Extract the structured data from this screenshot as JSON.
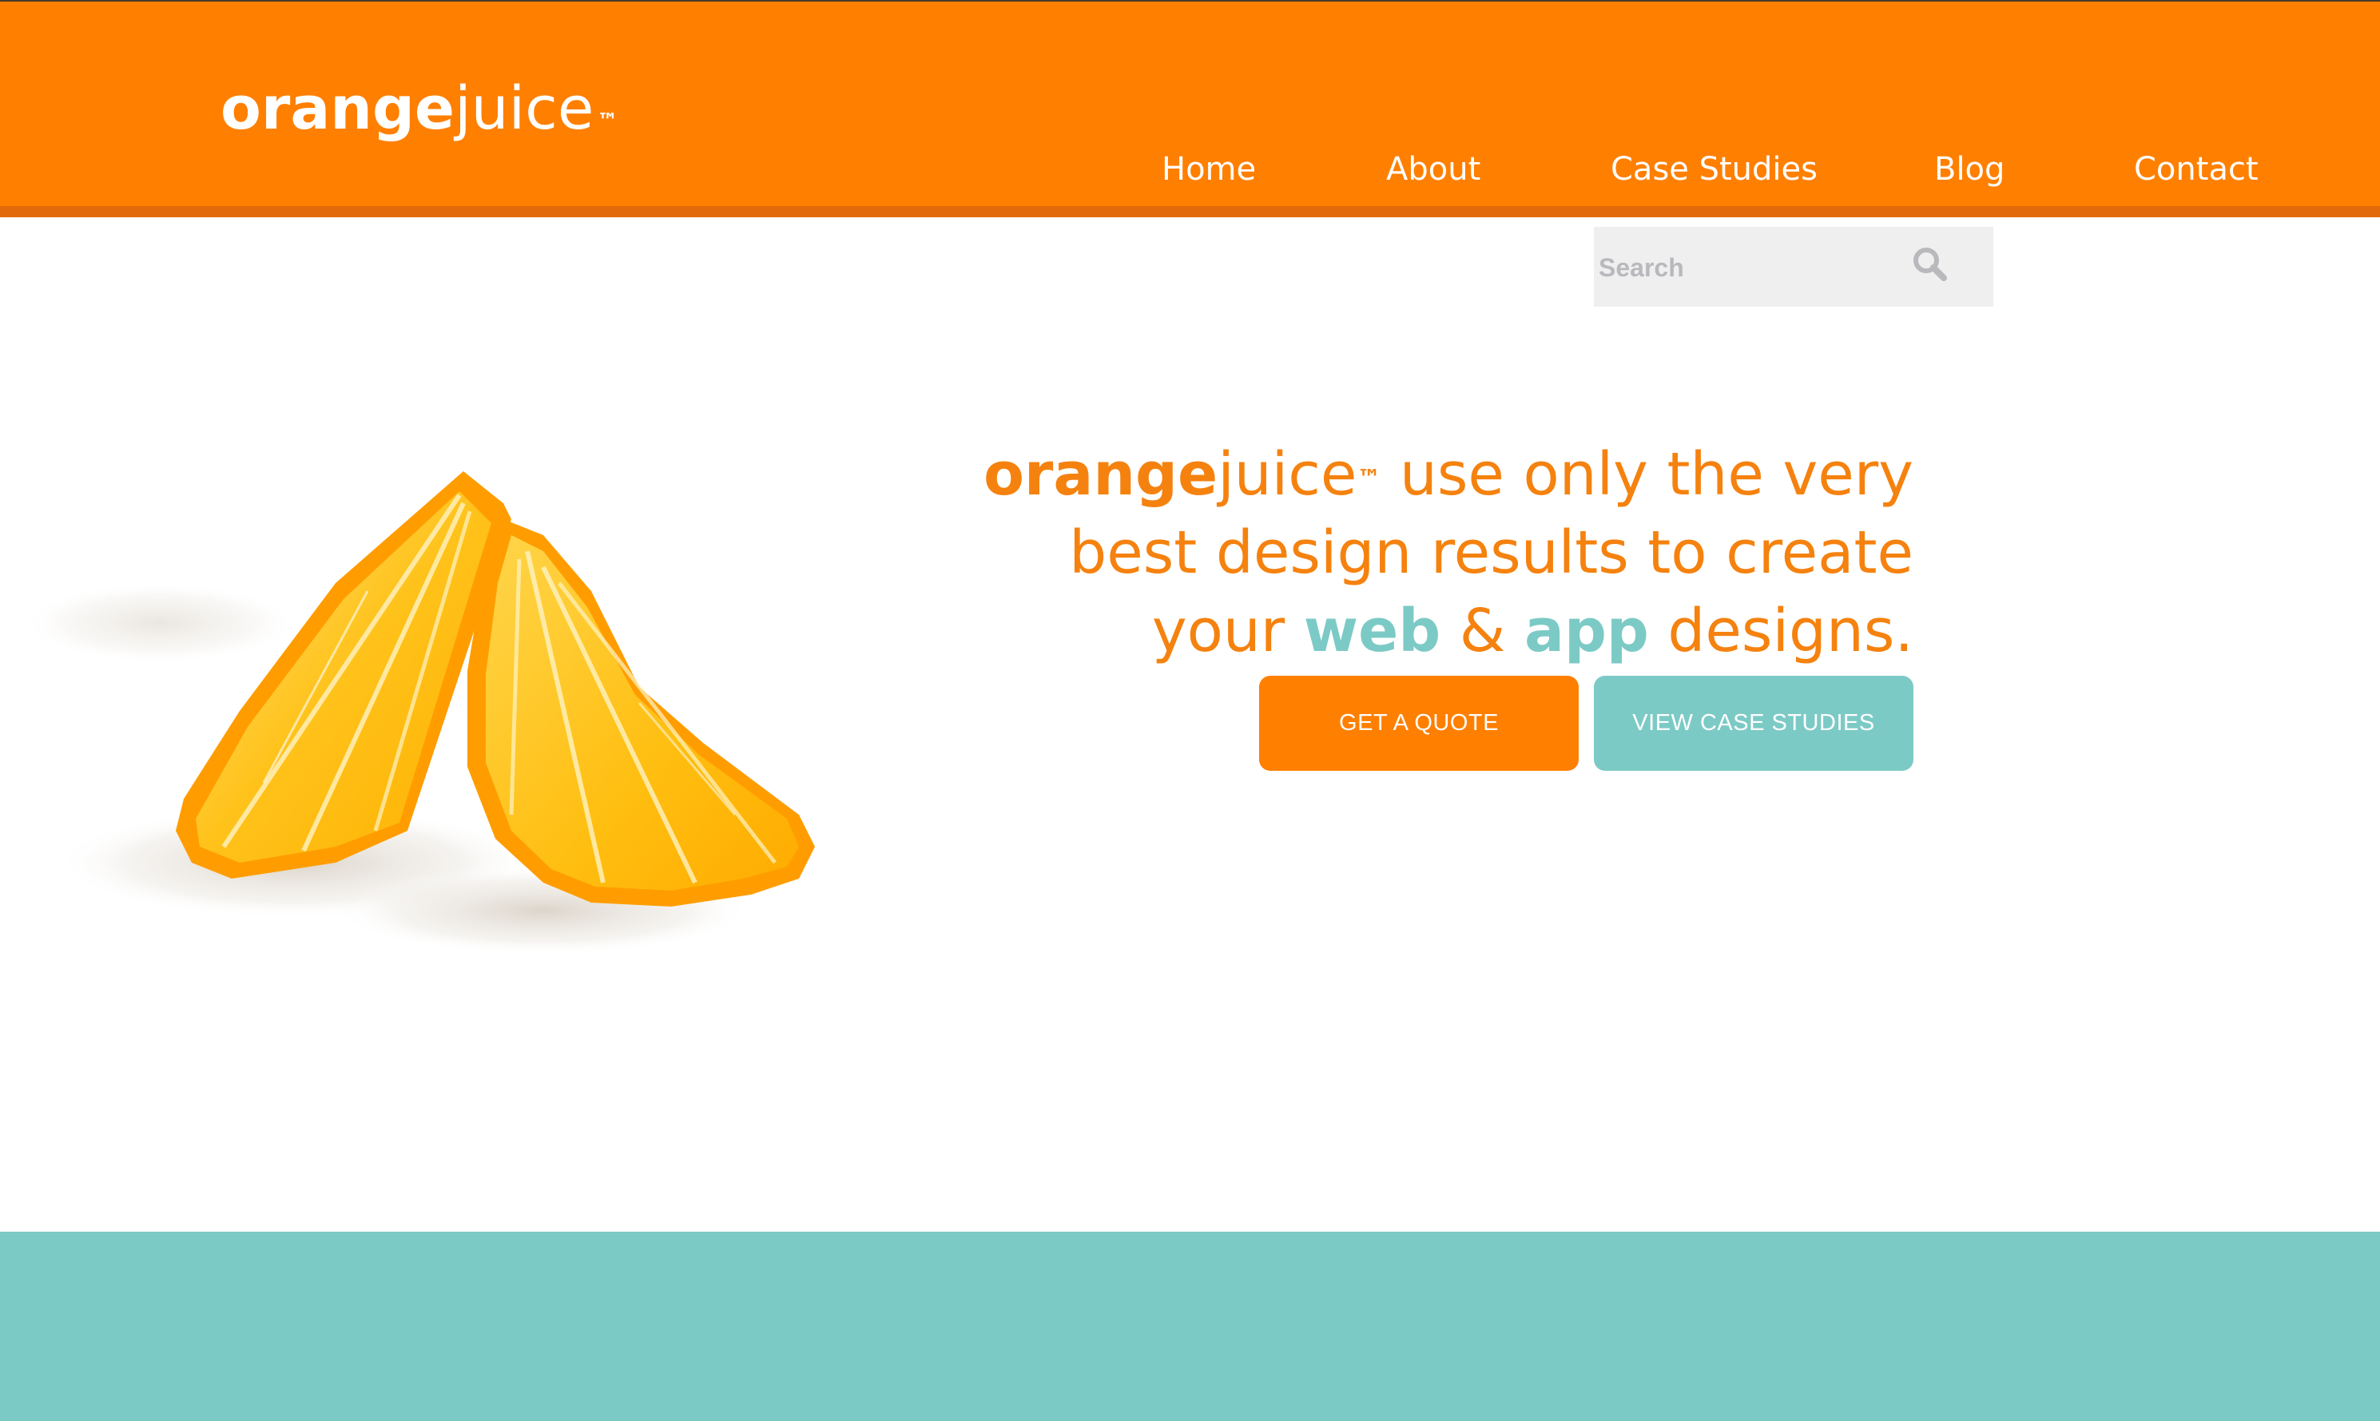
{
  "brand": {
    "logo_bold": "orange",
    "logo_light": "juice",
    "logo_tm": "™"
  },
  "nav": {
    "items": [
      {
        "label": "Home"
      },
      {
        "label": "About"
      },
      {
        "label": "Case Studies"
      },
      {
        "label": "Blog"
      },
      {
        "label": "Contact"
      }
    ]
  },
  "search": {
    "placeholder": "Search",
    "icon": "search-icon"
  },
  "hero": {
    "brand_bold": "orange",
    "brand_light": "juice",
    "brand_tm": "™",
    "line1_rest": " use only the very",
    "line2": "best design results to create",
    "line3_start": "your ",
    "word_web": "web",
    "amp": " & ",
    "word_app": "app",
    "line3_end": " designs."
  },
  "buttons": {
    "quote_label": "GET A QUOTE",
    "cases_label": "VIEW CASE STUDIES"
  },
  "colors": {
    "brand_orange": "#ff7f00",
    "header_strip": "#e36a0a",
    "accent_teal": "#7ccac6",
    "hero_text": "#f5820f",
    "search_bg": "#efeff0"
  }
}
